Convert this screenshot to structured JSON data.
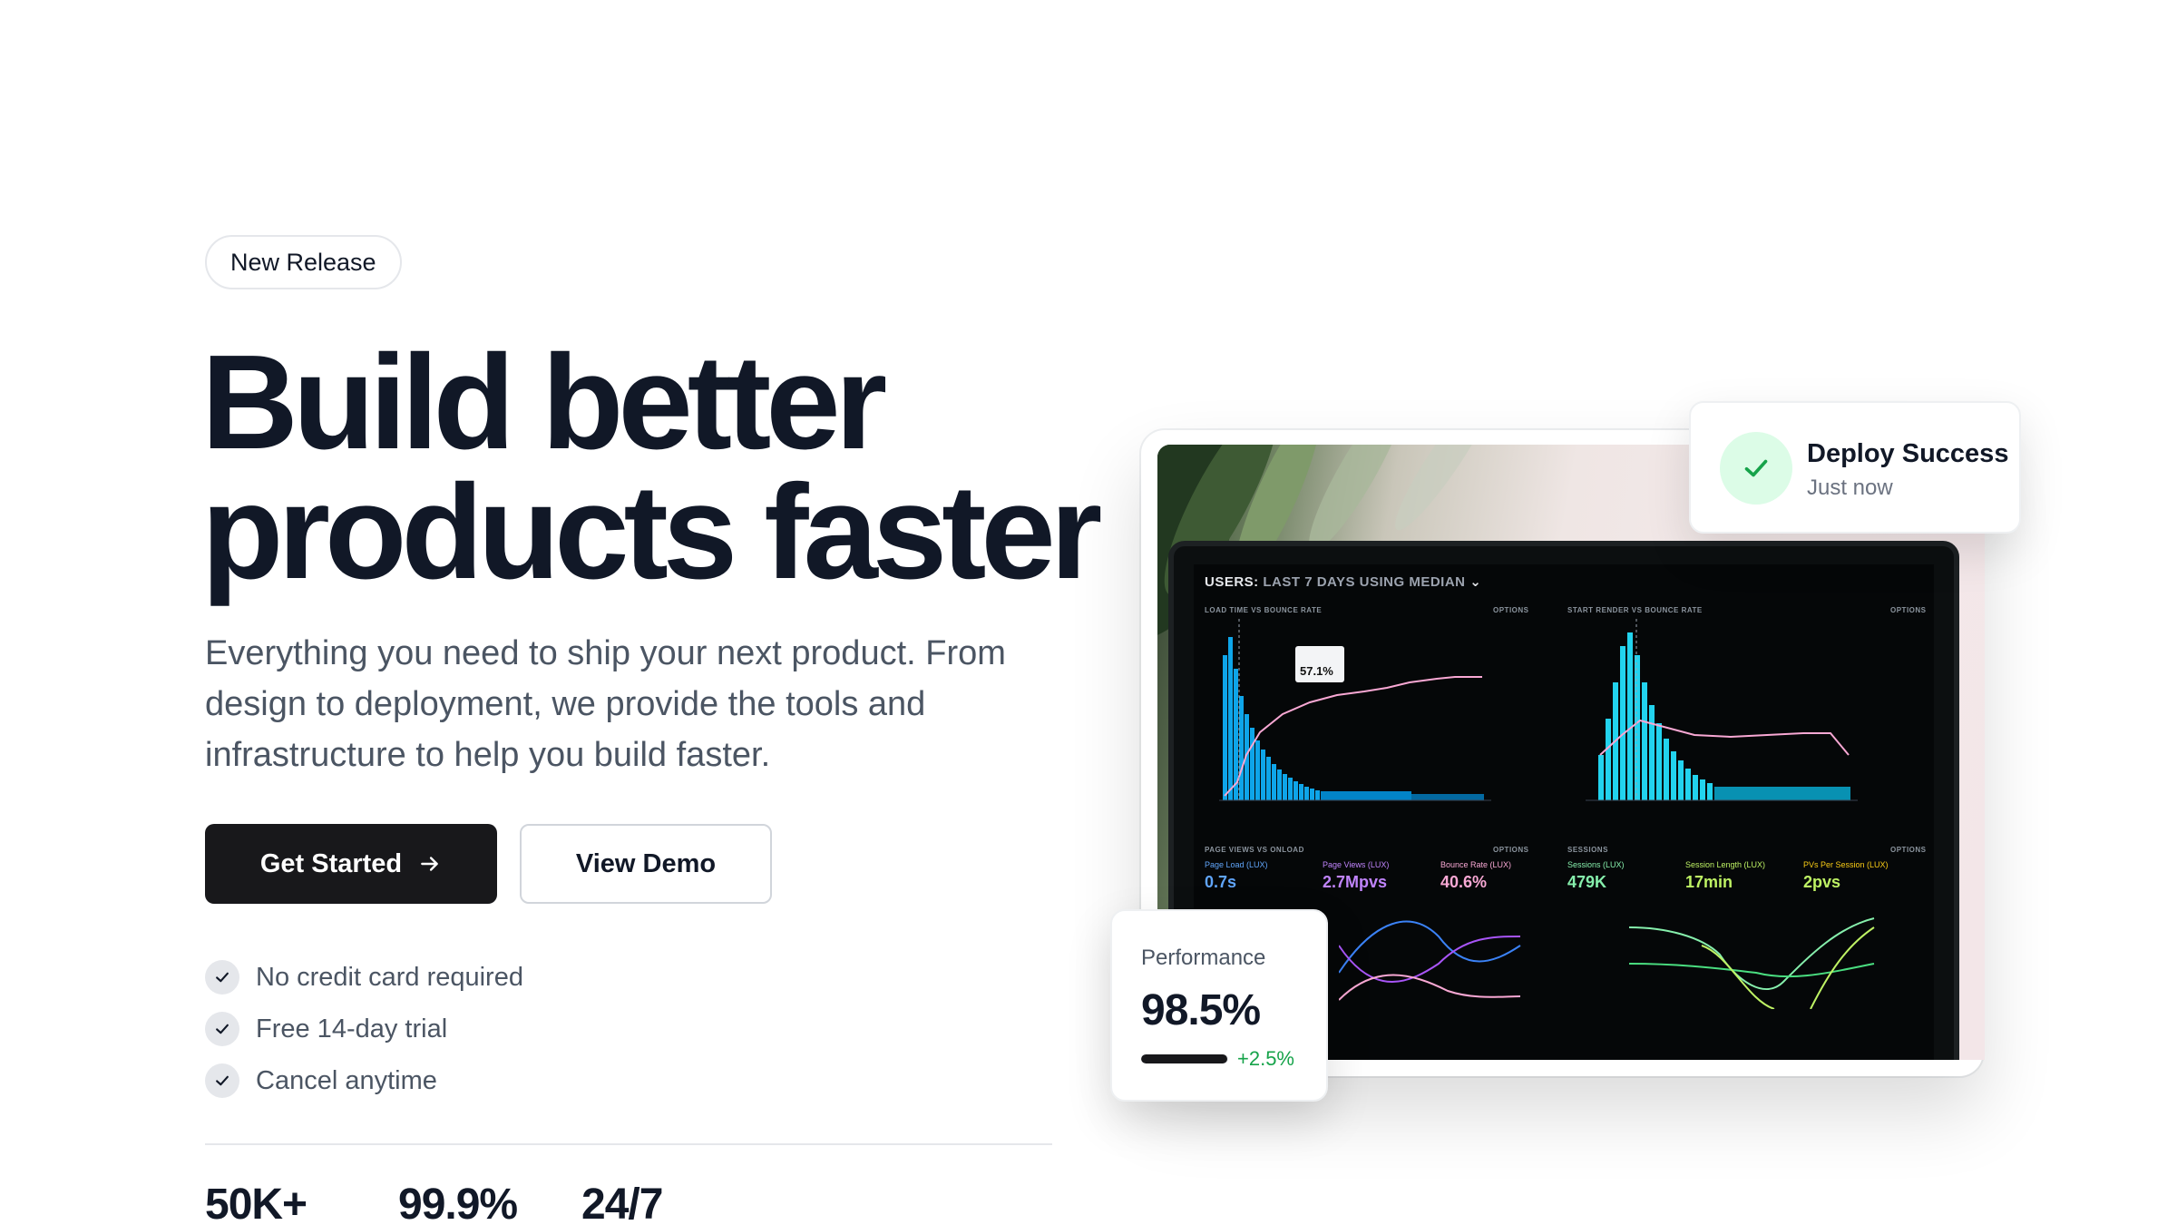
{
  "hero": {
    "badge": "New Release",
    "headline_line1": "Build better",
    "headline_line2": "products faster",
    "subtitle": "Everything you need to ship your next product. From design to deployment, we provide the tools and infrastructure to help you build faster.",
    "primary_button": "Get Started",
    "secondary_button": "View Demo",
    "checklist": [
      "No credit card required",
      "Free 14-day trial",
      "Cancel anytime"
    ],
    "stats": [
      "50K+",
      "99.9%",
      "24/7"
    ]
  },
  "deploy_card": {
    "title": "Deploy Success",
    "subtitle": "Just now",
    "accent": "#16a34a"
  },
  "performance_card": {
    "label": "Performance",
    "value": "98.5%",
    "delta": "+2.5%",
    "progress": 0.985
  },
  "dashboard_screen": {
    "title_bold": "USERS:",
    "title_rest": "LAST 7 DAYS USING MEDIAN",
    "panel_top_left": "LOAD TIME VS BOUNCE RATE",
    "panel_top_right": "START RENDER VS BOUNCE RATE",
    "panel_bottom_left": "PAGE VIEWS VS ONLOAD",
    "panel_bottom_right": "SESSIONS",
    "options": "OPTIONS",
    "tooltip": "57.1%",
    "kpis_left": [
      {
        "label": "Page Load (LUX)",
        "value": "0.7s"
      },
      {
        "label": "Page Views (LUX)",
        "value": "2.7Mpvs"
      },
      {
        "label": "Bounce Rate (LUX)",
        "value": "40.6%"
      }
    ],
    "kpis_right": [
      {
        "label": "Sessions (LUX)",
        "value": "479K"
      },
      {
        "label": "Session Length (LUX)",
        "value": "17min"
      },
      {
        "label": "PVs Per Session (LUX)",
        "value": "2pvs"
      }
    ]
  },
  "colors": {
    "primary": "#18181b",
    "text": "#111827",
    "muted": "#4b5563",
    "success": "#16a34a",
    "chart_bar": "#0ea5e9",
    "chart_bar_right": "#22d3ee",
    "chart_line": "#f9a8d4"
  }
}
